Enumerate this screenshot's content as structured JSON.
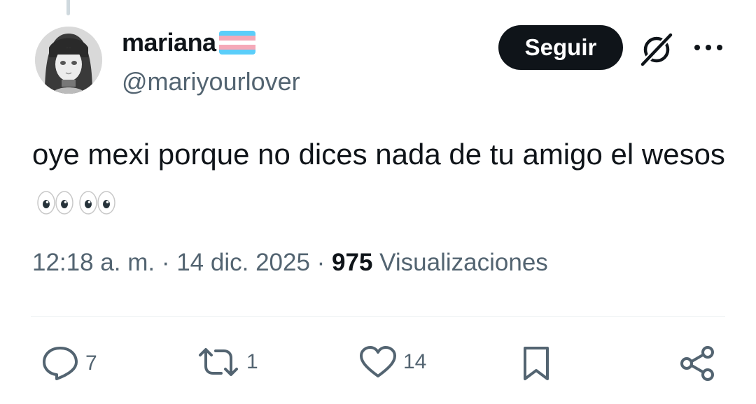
{
  "author": {
    "display_name": "mariana",
    "handle": "@mariyourlover",
    "flag_colors": [
      "#5BCEFA",
      "#F5A9B8",
      "#FFFFFF",
      "#F5A9B8",
      "#5BCEFA"
    ],
    "avatar_icon": "avatar-illustration"
  },
  "actions_header": {
    "follow_label": "Seguir",
    "grok_icon": "grok-icon",
    "more_icon": "more-icon"
  },
  "tweet": {
    "text": "oye mexi porque no dices nada de tu amigo el wesos",
    "emoji": "eyes-emoji-x2"
  },
  "meta": {
    "time": "12:18 a. m.",
    "sep1": " · ",
    "date": "14 dic. 2025",
    "sep2": " · ",
    "views_count": "975",
    "views_label": " Visualizaciones"
  },
  "engagement": {
    "replies": "7",
    "reposts": "1",
    "likes": "14"
  },
  "colors": {
    "text": "#0f1419",
    "secondary": "#536471",
    "button_bg": "#0f1419"
  }
}
